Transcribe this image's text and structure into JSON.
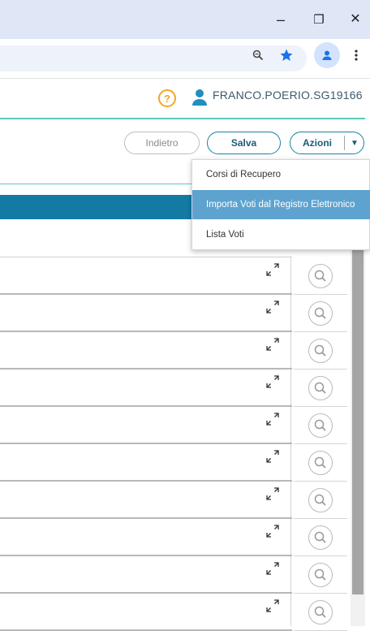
{
  "browser": {
    "window_controls": {
      "minimize": "–",
      "restore": "❐",
      "close": "✕"
    },
    "address_bar_icons": [
      "zoom-icon",
      "bookmark-star-icon",
      "profile-icon",
      "menu-dots-icon"
    ]
  },
  "header": {
    "help_label": "?",
    "username": "FRANCO.POERIO.SG19166"
  },
  "toolbar": {
    "back_label": "Indietro",
    "save_label": "Salva",
    "actions_label": "Azioni"
  },
  "actions_menu": {
    "items": [
      {
        "label": "Corsi di Recupero"
      },
      {
        "label": "Importa Voti dal Registro Elettronico",
        "highlighted": true
      },
      {
        "label": "Lista Voti"
      }
    ]
  },
  "colors": {
    "accent_teal": "#5cc9bf",
    "table_header": "#137aa3",
    "button_border": "#1a80a5",
    "menu_highlight": "#5ea3cf",
    "help_orange": "#f5a623"
  },
  "rows_count": 10
}
